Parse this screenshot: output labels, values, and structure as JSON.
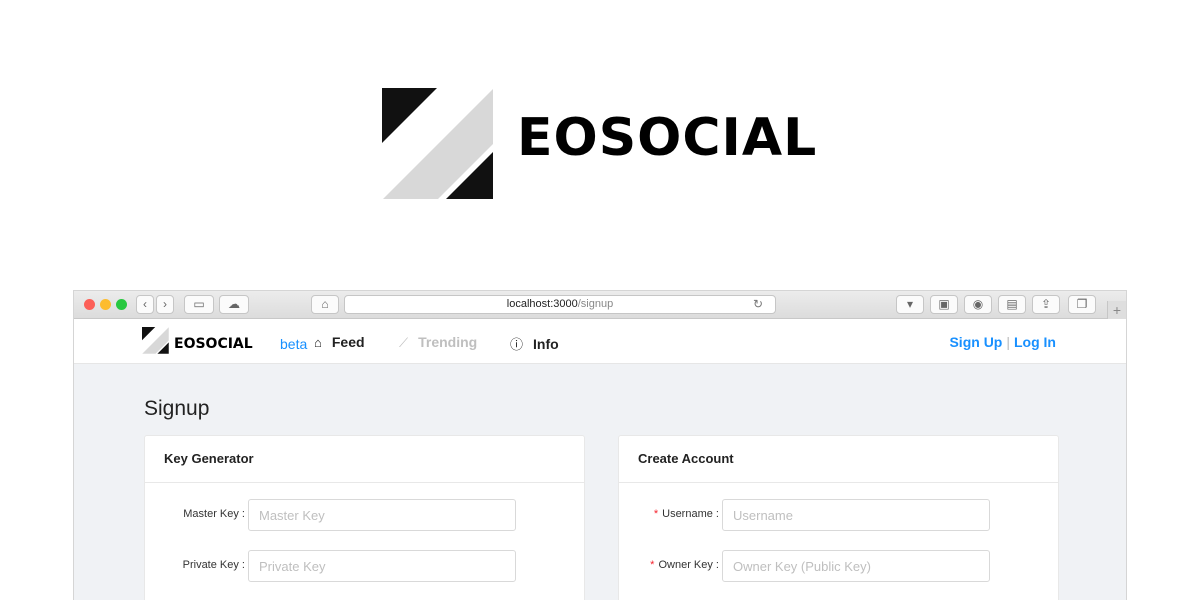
{
  "hero": {
    "title": "EOSOCIAL"
  },
  "browser": {
    "url_host": "localhost:3000",
    "url_path": "/signup"
  },
  "nav": {
    "brand": "EOSOCIAL",
    "beta": "beta",
    "items": [
      {
        "label": "Feed",
        "icon": "home-icon",
        "enabled": true
      },
      {
        "label": "Trending",
        "icon": "line-chart-icon",
        "enabled": false
      },
      {
        "label": "Info",
        "icon": "info-circle-icon",
        "enabled": true
      }
    ],
    "signup": "Sign Up",
    "separator": "|",
    "login": "Log In"
  },
  "page": {
    "title": "Signup"
  },
  "key_generator": {
    "title": "Key Generator",
    "fields": [
      {
        "label": "Master Key",
        "placeholder": "Master Key",
        "value": ""
      },
      {
        "label": "Private Key",
        "placeholder": "Private Key",
        "value": ""
      }
    ]
  },
  "create_account": {
    "title": "Create Account",
    "fields": [
      {
        "label": "Username",
        "placeholder": "Username",
        "value": ""
      },
      {
        "label": "Owner Key",
        "placeholder": "Owner Key (Public Key)",
        "value": ""
      }
    ]
  },
  "colors": {
    "accent": "#1890ff",
    "required": "#f5222d",
    "page_bg": "#f0f2f5"
  }
}
